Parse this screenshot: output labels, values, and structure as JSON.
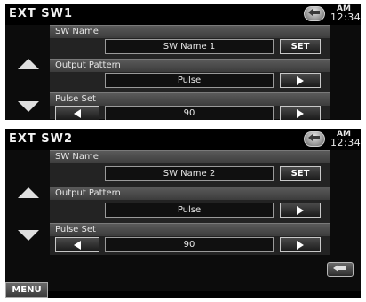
{
  "screens": [
    {
      "title": "EXT SW1",
      "clock": {
        "ampm": "AM",
        "time": "12:34"
      },
      "sw_name": {
        "label": "SW Name",
        "value": "SW  Name 1",
        "set_label": "SET"
      },
      "output_pattern": {
        "label": "Output Pattern",
        "value": "Pulse"
      },
      "pulse_set": {
        "label": "Pulse Set",
        "value": "90"
      }
    },
    {
      "title": "EXT SW2",
      "clock": {
        "ampm": "AM",
        "time": "12:34"
      },
      "sw_name": {
        "label": "SW Name",
        "value": "SW  Name 2",
        "set_label": "SET"
      },
      "output_pattern": {
        "label": "Output Pattern",
        "value": "Pulse"
      },
      "pulse_set": {
        "label": "Pulse Set",
        "value": "90"
      },
      "menu_label": "MENU"
    }
  ],
  "icons": {
    "return": "return-arrow-icon",
    "scroll_up": "triangle-up-icon",
    "scroll_down": "triangle-down-icon",
    "next": "triangle-right-icon",
    "prev": "triangle-left-icon"
  }
}
